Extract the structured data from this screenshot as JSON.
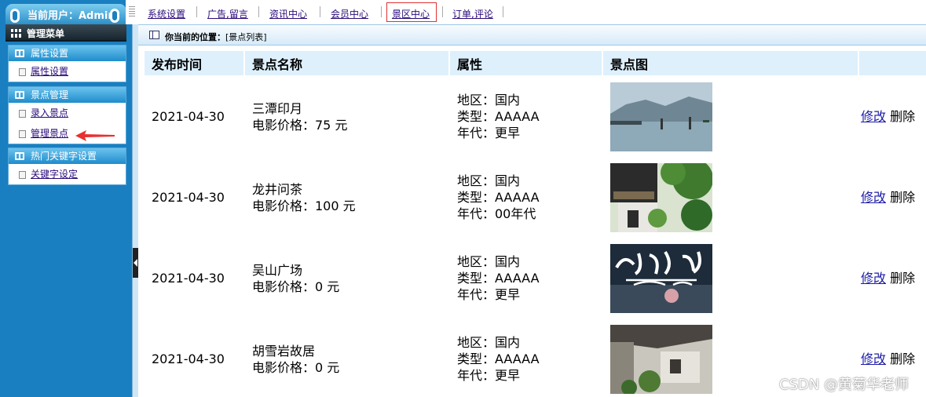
{
  "sidebar": {
    "user_label": "当前用户：Admin",
    "menu_title": "管理菜单",
    "groups": [
      {
        "title": "属性设置",
        "items": [
          "属性设置"
        ]
      },
      {
        "title": "景点管理",
        "items": [
          "录入景点",
          "管理景点"
        ]
      },
      {
        "title": "热门关键字设置",
        "items": [
          "关键字设定"
        ]
      }
    ],
    "arrow_color": "#e83030"
  },
  "topnav": {
    "items": [
      "系统设置",
      "广告,留言",
      "资讯中心",
      "会员中心",
      "景区中心",
      "订单,评论"
    ],
    "active": "景区中心"
  },
  "breadcrumb": {
    "prefix": "你当前的位置：",
    "location": "[景点列表]"
  },
  "table": {
    "headers": [
      "发布时间",
      "景点名称",
      "属性",
      "景点图",
      ""
    ],
    "rows": [
      {
        "date": "2021-04-30",
        "name": "三潭印月",
        "price": "电影价格：75 元",
        "region": "地区：国内",
        "type": "类型：AAAAA",
        "era": "年代：更早",
        "edit": "修改",
        "delete": "删除"
      },
      {
        "date": "2021-04-30",
        "name": "龙井问茶",
        "price": "电影价格：100 元",
        "region": "地区：国内",
        "type": "类型：AAAAA",
        "era": "年代：00年代",
        "edit": "修改",
        "delete": "删除"
      },
      {
        "date": "2021-04-30",
        "name": "吴山广场",
        "price": "电影价格：0 元",
        "region": "地区：国内",
        "type": "类型：AAAAA",
        "era": "年代：更早",
        "edit": "修改",
        "delete": "删除"
      },
      {
        "date": "2021-04-30",
        "name": "胡雪岩故居",
        "price": "电影价格：0 元",
        "region": "地区：国内",
        "type": "类型：AAAAA",
        "era": "年代：更早",
        "edit": "修改",
        "delete": "删除"
      }
    ]
  },
  "watermark": "CSDN @黄菊华老师"
}
